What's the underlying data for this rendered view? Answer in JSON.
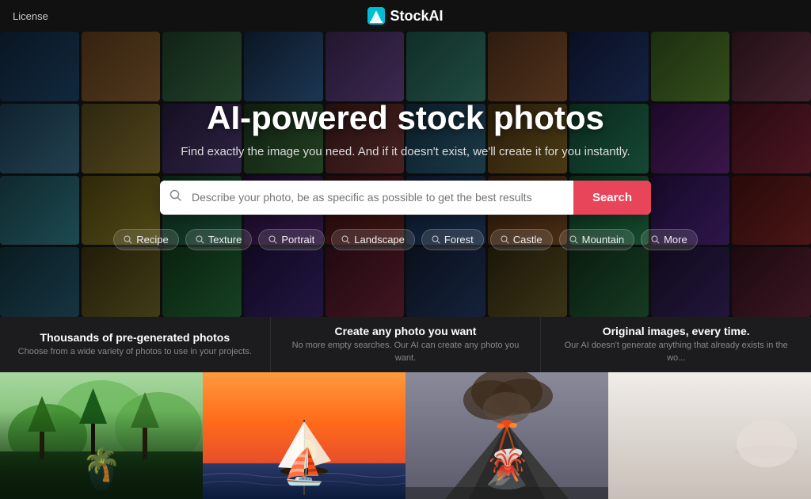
{
  "navbar": {
    "license_label": "License",
    "logo_text": "StockAI"
  },
  "hero": {
    "title": "AI-powered stock photos",
    "subtitle": "Find exactly the image you need. And if it doesn't exist, we'll create it for you instantly.",
    "search": {
      "placeholder": "Describe your photo, be as specific as possible to get the best results",
      "button_label": "Search"
    },
    "tags": [
      {
        "label": "Recipe"
      },
      {
        "label": "Texture"
      },
      {
        "label": "Portrait"
      },
      {
        "label": "Landscape"
      },
      {
        "label": "Forest"
      },
      {
        "label": "Castle"
      },
      {
        "label": "Mountain"
      },
      {
        "label": "More"
      }
    ]
  },
  "features": [
    {
      "title": "Thousands of pre-generated photos",
      "description": "Choose from a wide variety of photos to use in your projects."
    },
    {
      "title": "Create any photo you want",
      "description": "No more empty searches. Our AI can create any photo you want."
    },
    {
      "title": "Original images, every time.",
      "description": "Our AI doesn't generate anything that already exists in the wo..."
    }
  ],
  "icons": {
    "search": "🔍",
    "logo": "✦"
  }
}
